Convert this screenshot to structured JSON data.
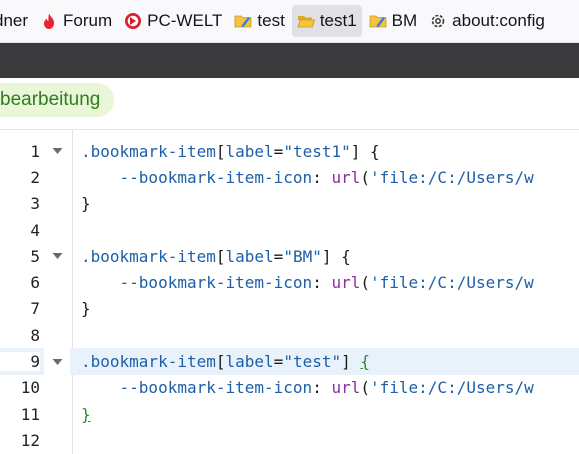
{
  "bookmarks": [
    {
      "label": "dner",
      "icon": "none"
    },
    {
      "label": "Forum",
      "icon": "fire-icon"
    },
    {
      "label": "PC-WELT",
      "icon": "pcwelt-logo-icon"
    },
    {
      "label": "test",
      "icon": "edit-folder-icon"
    },
    {
      "label": "test1",
      "icon": "open-folder-icon",
      "active": true
    },
    {
      "label": "BM",
      "icon": "edit-folder-icon"
    },
    {
      "label": "about:config",
      "icon": "gear-icon"
    }
  ],
  "editor_tab": {
    "label": "bearbeitung"
  },
  "code_lines": [
    {
      "num": "1",
      "fold": true,
      "tokens": [
        {
          "t": ".bookmark-item",
          "c": "t-sel"
        },
        {
          "t": "[",
          "c": ""
        },
        {
          "t": "label",
          "c": "t-attr"
        },
        {
          "t": "=",
          "c": ""
        },
        {
          "t": "\"test1\"",
          "c": "t-str"
        },
        {
          "t": "] {",
          "c": ""
        }
      ]
    },
    {
      "num": "2",
      "fold": false,
      "tokens": [
        {
          "t": "    --bookmark-item-icon",
          "c": "t-prop"
        },
        {
          "t": ": ",
          "c": ""
        },
        {
          "t": "url",
          "c": "t-func"
        },
        {
          "t": "(",
          "c": ""
        },
        {
          "t": "'file:/C:/Users/w",
          "c": "t-val"
        }
      ]
    },
    {
      "num": "3",
      "fold": false,
      "tokens": [
        {
          "t": "}",
          "c": ""
        }
      ]
    },
    {
      "num": "4",
      "fold": false,
      "tokens": []
    },
    {
      "num": "5",
      "fold": true,
      "tokens": [
        {
          "t": ".bookmark-item",
          "c": "t-sel"
        },
        {
          "t": "[",
          "c": ""
        },
        {
          "t": "label",
          "c": "t-attr"
        },
        {
          "t": "=",
          "c": ""
        },
        {
          "t": "\"BM\"",
          "c": "t-str"
        },
        {
          "t": "] {",
          "c": ""
        }
      ]
    },
    {
      "num": "6",
      "fold": false,
      "tokens": [
        {
          "t": "    --bookmark-item-icon",
          "c": "t-prop"
        },
        {
          "t": ": ",
          "c": ""
        },
        {
          "t": "url",
          "c": "t-func"
        },
        {
          "t": "(",
          "c": ""
        },
        {
          "t": "'file:/C:/Users/w",
          "c": "t-val"
        }
      ]
    },
    {
      "num": "7",
      "fold": false,
      "tokens": [
        {
          "t": "}",
          "c": ""
        }
      ]
    },
    {
      "num": "8",
      "fold": false,
      "tokens": []
    },
    {
      "num": "9",
      "fold": true,
      "active": true,
      "tokens": [
        {
          "t": ".bookmark-item",
          "c": "t-sel"
        },
        {
          "t": "[",
          "c": ""
        },
        {
          "t": "label",
          "c": "t-attr"
        },
        {
          "t": "=",
          "c": ""
        },
        {
          "t": "\"test\"",
          "c": "t-str"
        },
        {
          "t": "] ",
          "c": ""
        },
        {
          "t": "{",
          "c": "t-brace-match"
        }
      ]
    },
    {
      "num": "10",
      "fold": false,
      "tokens": [
        {
          "t": "    --bookmark-item-icon",
          "c": "t-prop"
        },
        {
          "t": ": ",
          "c": ""
        },
        {
          "t": "url",
          "c": "t-func"
        },
        {
          "t": "(",
          "c": ""
        },
        {
          "t": "'file:/C:/Users/w",
          "c": "t-val"
        }
      ]
    },
    {
      "num": "11",
      "fold": false,
      "tokens": [
        {
          "t": "}",
          "c": "t-brace-match"
        }
      ]
    },
    {
      "num": "12",
      "fold": false,
      "tokens": []
    }
  ],
  "colors": {
    "accent_green": "#2e7d20",
    "active_line": "#e9f1fb",
    "dark_strip": "#3a3a3c"
  }
}
